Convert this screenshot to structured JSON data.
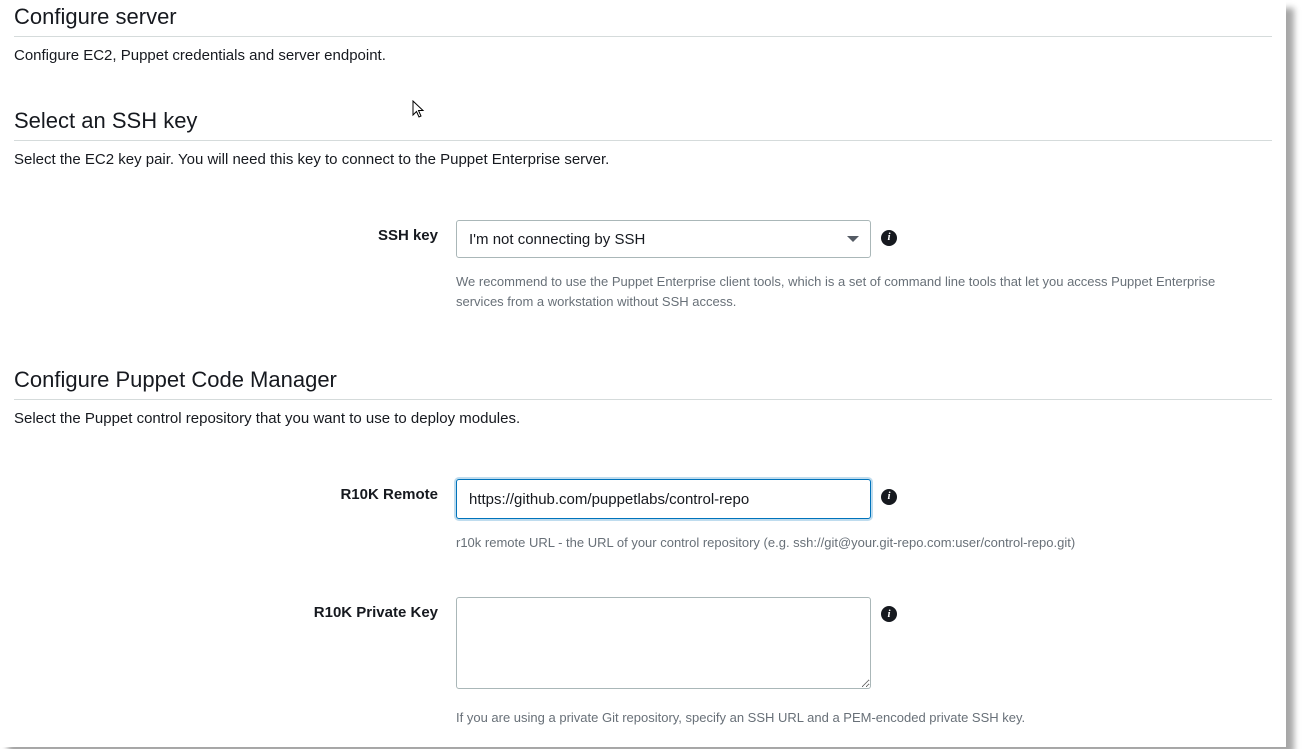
{
  "sections": {
    "configure_server": {
      "title": "Configure server",
      "desc": "Configure EC2, Puppet credentials and server endpoint."
    },
    "ssh_key": {
      "title": "Select an SSH key",
      "desc": "Select the EC2 key pair. You will need this key to connect to the Puppet Enterprise server.",
      "label": "SSH key",
      "selected": "I'm not connecting by SSH",
      "hint": "We recommend to use the Puppet Enterprise client tools, which is a set of command line tools that let you access Puppet Enterprise services from a workstation without SSH access."
    },
    "code_manager": {
      "title": "Configure Puppet Code Manager",
      "desc": "Select the Puppet control repository that you want to use to deploy modules.",
      "r10k_remote": {
        "label": "R10K Remote",
        "value": "https://github.com/puppetlabs/control-repo",
        "hint": "r10k remote URL - the URL of your control repository (e.g. ssh://git@your.git-repo.com:user/control-repo.git)"
      },
      "r10k_private_key": {
        "label": "R10K Private Key",
        "value": "",
        "hint": "If you are using a private Git repository, specify an SSH URL and a PEM-encoded private SSH key."
      }
    }
  },
  "icons": {
    "info": "i"
  }
}
